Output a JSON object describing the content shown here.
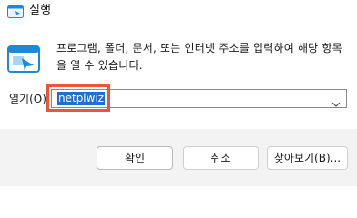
{
  "window": {
    "title": "실행"
  },
  "dialog": {
    "description": "프로그램, 폴더, 문서, 또는 인터넷 주소를 입력하여 해당 항목을 열 수 있습니다.",
    "open_label": "열기(",
    "open_accel": "O",
    "open_label_end": "):",
    "input_value": "netplwiz"
  },
  "buttons": {
    "ok": "확인",
    "cancel": "취소",
    "browse": "찾아보기(B)..."
  },
  "colors": {
    "selection": "#1f6fd1",
    "highlight": "#e8563c",
    "footer": "#f3f3f3"
  },
  "icons": {
    "title": "run-icon",
    "app": "run-icon",
    "combo": "chevron-down-icon"
  }
}
